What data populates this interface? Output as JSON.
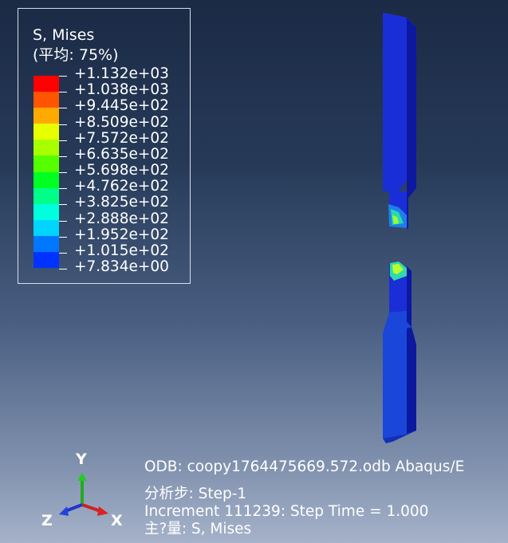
{
  "legend": {
    "title": "S, Mises",
    "subtitle": "(平均: 75%)",
    "labels": [
      "+1.132e+03",
      "+1.038e+03",
      "+9.445e+02",
      "+8.509e+02",
      "+7.572e+02",
      "+6.635e+02",
      "+5.698e+02",
      "+4.762e+02",
      "+3.825e+02",
      "+2.888e+02",
      "+1.952e+02",
      "+1.015e+02",
      "+7.834e+00"
    ],
    "colors": [
      "#ff0000",
      "#ff5500",
      "#ffaa00",
      "#e8ff00",
      "#a8ff00",
      "#55ff00",
      "#00ff22",
      "#00ff88",
      "#00ffdd",
      "#00d4ff",
      "#0077ff",
      "#0033ff",
      "#0000ff"
    ]
  },
  "info": {
    "odb": "ODB: coopy1764475669.572.odb    Abaqus/E",
    "step": "分析步: Step-1",
    "increment": "Increment     111239: Step Time =     1.000",
    "variable": "主?量: S, Mises"
  },
  "triad": {
    "y": "Y",
    "z": "Z",
    "x": "X"
  },
  "colors": {
    "mesh_blue": "#1a2ed8",
    "mesh_side": "#0d18a0",
    "background_top": "#1b2a45",
    "background_bottom": "#a5b2c9"
  }
}
